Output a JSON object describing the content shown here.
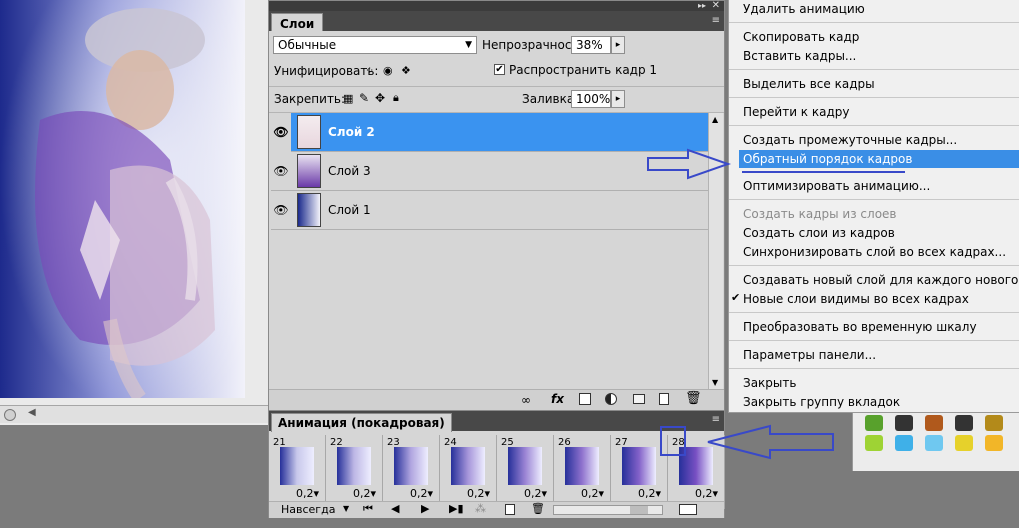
{
  "layers_panel": {
    "title": "Слои",
    "blend_mode": "Обычные",
    "opacity_label": "Непрозрачность:",
    "opacity_value": "38%",
    "unify_label": "Унифицировать:",
    "propagate_label": "Распространить кадр 1",
    "lock_label": "Закрепить:",
    "fill_label": "Заливка:",
    "fill_value": "100%",
    "layers": [
      {
        "name": "Слой 2",
        "selected": true
      },
      {
        "name": "Слой 3",
        "selected": false
      },
      {
        "name": "Слой 1",
        "selected": false
      }
    ],
    "bottom_icons": [
      "link-icon",
      "fx-icon",
      "mask-icon",
      "adjustment-icon",
      "group-icon",
      "new-layer-icon",
      "trash-icon"
    ]
  },
  "animation_panel": {
    "title": "Анимация (покадровая)",
    "frames": [
      {
        "num": "21",
        "delay": "0,2▾"
      },
      {
        "num": "22",
        "delay": "0,2▾"
      },
      {
        "num": "23",
        "delay": "0,2▾"
      },
      {
        "num": "24",
        "delay": "0,2▾"
      },
      {
        "num": "25",
        "delay": "0,2▾"
      },
      {
        "num": "26",
        "delay": "0,2▾"
      },
      {
        "num": "27",
        "delay": "0,2▾"
      },
      {
        "num": "28",
        "delay": "0,2▾"
      }
    ],
    "loop_label": "Навсегда"
  },
  "context_menu": {
    "items": [
      {
        "label": "Удалить анимацию"
      },
      {
        "label": "Скопировать кадр"
      },
      {
        "label": "Вставить кадры..."
      },
      {
        "label": "Выделить все кадры"
      },
      {
        "label": "Перейти к кадру"
      },
      {
        "label": "Создать промежуточные кадры..."
      },
      {
        "label": "Обратный порядок кадров",
        "highlighted": true
      },
      {
        "label": "Оптимизировать анимацию..."
      },
      {
        "label": "Создать кадры из слоев",
        "disabled": true
      },
      {
        "label": "Создать слои из кадров"
      },
      {
        "label": "Синхронизировать слой во всех кадрах..."
      },
      {
        "label": "Создавать новый слой для каждого нового кадра"
      },
      {
        "label": "Новые слои видимы во всех кадрах",
        "checked": true
      },
      {
        "label": "Преобразовать во временную шкалу"
      },
      {
        "label": "Параметры панели..."
      },
      {
        "label": "Закрыть"
      },
      {
        "label": "Закрыть группу вкладок"
      }
    ]
  },
  "colors": {
    "selection": "#3a93f0",
    "menu_highlight": "#3a8ee6",
    "annotation_arrow": "#3949c9",
    "panel_bg": "#d6d6d6"
  }
}
